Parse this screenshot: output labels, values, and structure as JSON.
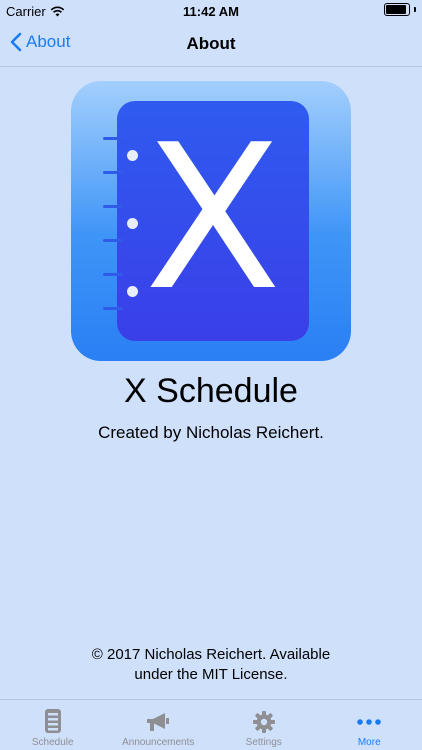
{
  "status": {
    "carrier": "Carrier",
    "time": "11:42 AM",
    "battery_level": 1.0
  },
  "nav": {
    "back_label": "About",
    "title": "About"
  },
  "app": {
    "icon_letter": "X",
    "name": "X Schedule",
    "credit": "Created by Nicholas Reichert."
  },
  "footer": {
    "license_line1": "© 2017 Nicholas Reichert.  Available",
    "license_line2": "under the MIT License."
  },
  "tabs": [
    {
      "label": "Schedule",
      "icon": "list-icon",
      "active": false
    },
    {
      "label": "Announcements",
      "icon": "megaphone-icon",
      "active": false
    },
    {
      "label": "Settings",
      "icon": "gear-icon",
      "active": false
    },
    {
      "label": "More",
      "icon": "more-icon",
      "active": true
    }
  ],
  "colors": {
    "accent": "#1a7cf5",
    "background": "#cfe0fb",
    "inactive_tab": "#8e8e93"
  }
}
